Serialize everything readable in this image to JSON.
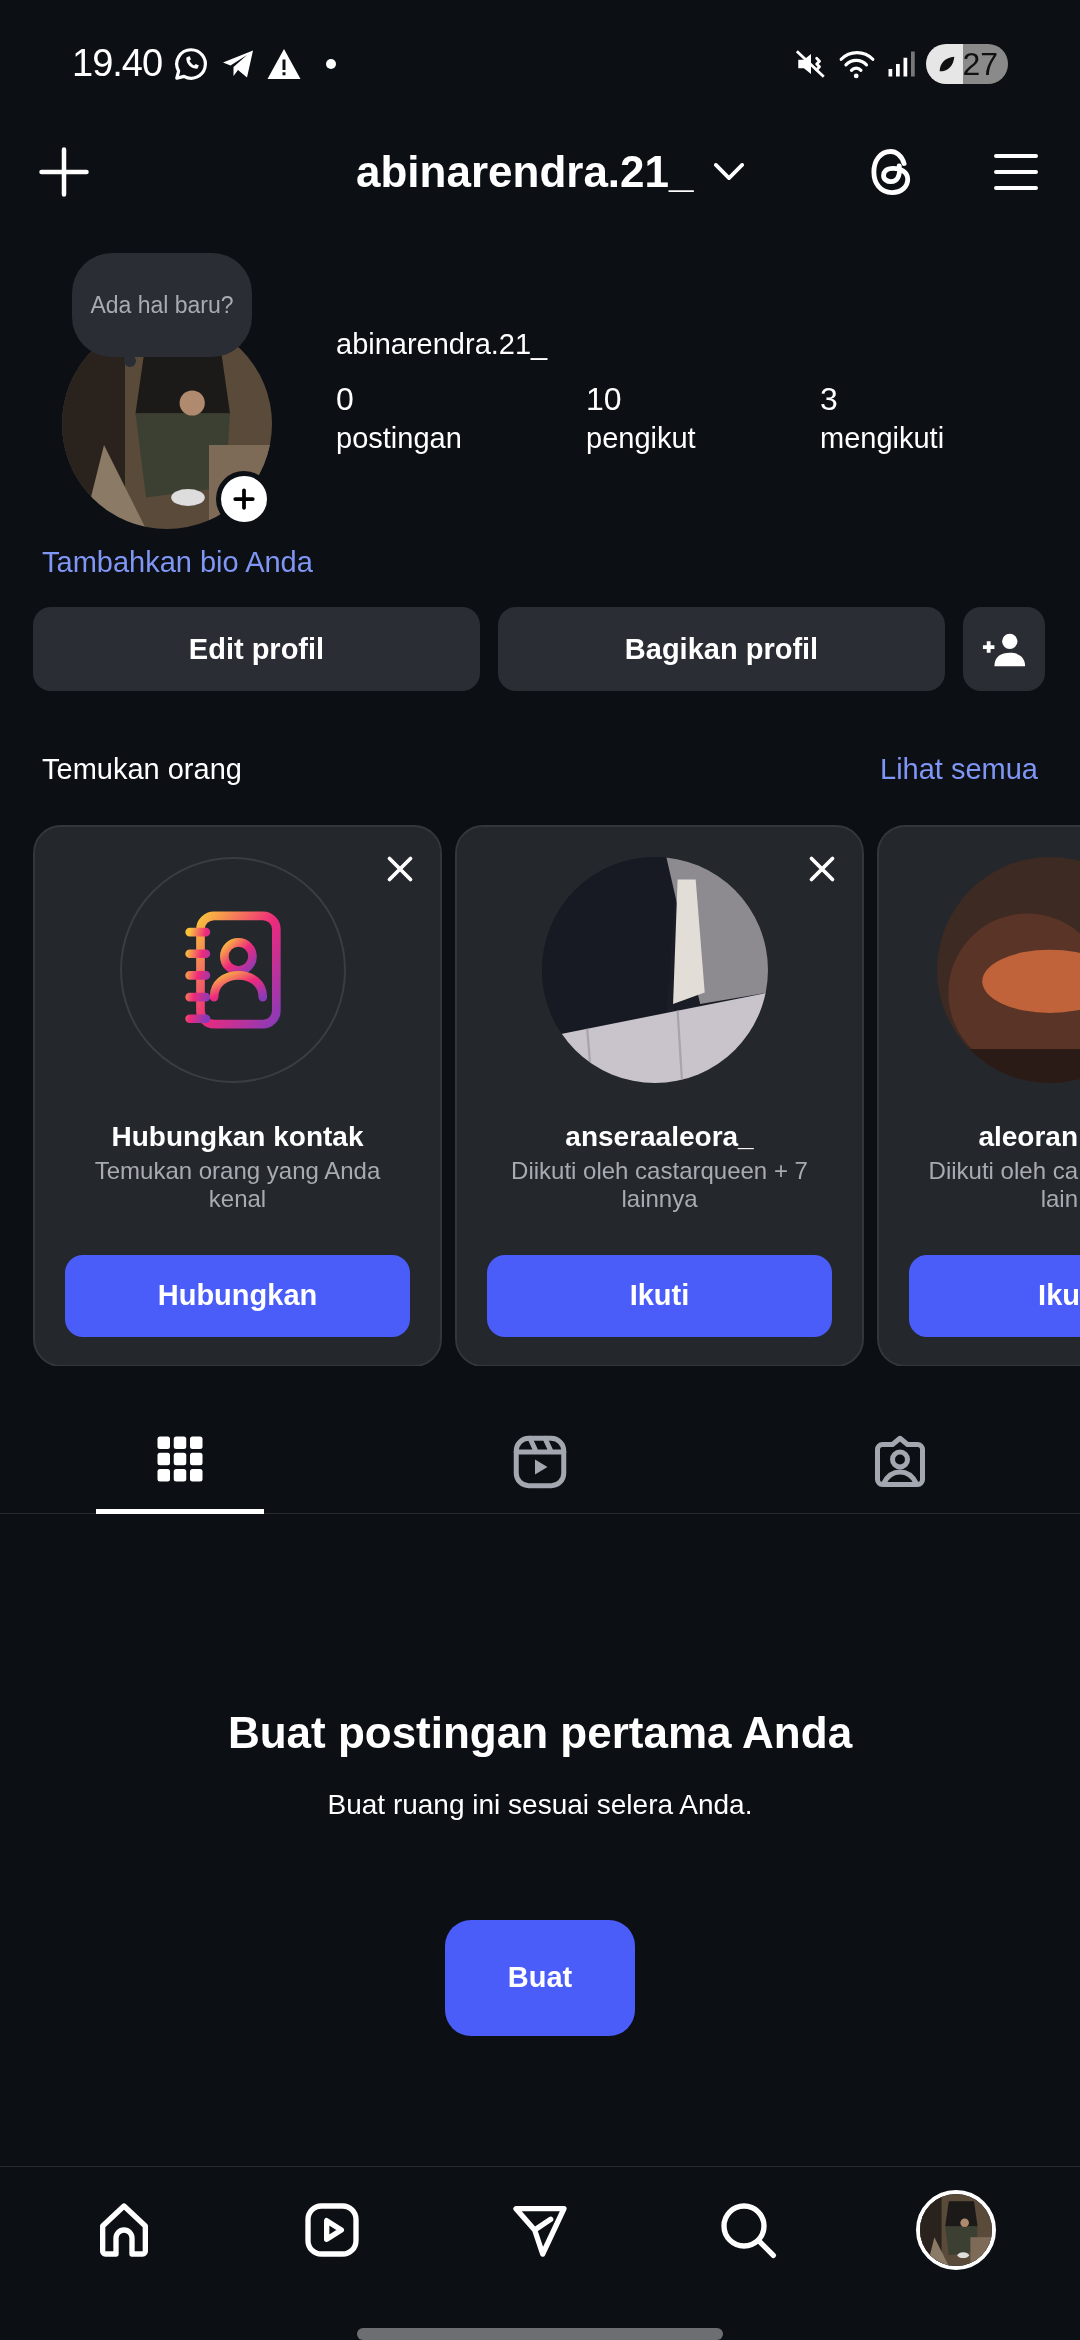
{
  "status_bar": {
    "time": "19.40",
    "battery": "27"
  },
  "header": {
    "username": "abinarendra.21_"
  },
  "profile": {
    "note": "Ada hal baru?",
    "name": "abinarendra.21_",
    "stats": [
      {
        "value": "0",
        "label": "postingan"
      },
      {
        "value": "10",
        "label": "pengikut"
      },
      {
        "value": "3",
        "label": "mengikuti"
      }
    ],
    "bio_link": "Tambahkan bio Anda",
    "buttons": [
      "Edit profil",
      "Bagikan profil"
    ]
  },
  "suggestions": {
    "title": "Temukan orang",
    "see_all": "Lihat semua",
    "cards": [
      {
        "kind": "contacts",
        "title": "Hubungkan kontak",
        "subtitle": "Temukan orang yang Anda kenal",
        "button": "Hubungkan",
        "dismissible": true
      },
      {
        "kind": "user",
        "title": "anseraaleora_",
        "subtitle": "Diikuti oleh castarqueen + 7 lainnya",
        "button": "Ikuti",
        "dismissible": true
      },
      {
        "kind": "user_cut",
        "title": "aleoran",
        "subtitle": "Diikuti oleh ca",
        "subtitle_2": "lain",
        "button": "Iku",
        "dismissible": false
      }
    ]
  },
  "tabs": [
    {
      "kind": "grid",
      "selected": true
    },
    {
      "kind": "reels",
      "selected": false
    },
    {
      "kind": "tagged",
      "selected": false
    }
  ],
  "empty_state": {
    "title": "Buat postingan pertama Anda",
    "subtitle": "Buat ruang ini sesuai selera Anda.",
    "button": "Buat"
  },
  "bottom_nav": [
    {
      "kind": "home"
    },
    {
      "kind": "reels"
    },
    {
      "kind": "send"
    },
    {
      "kind": "search"
    },
    {
      "kind": "profile"
    }
  ]
}
